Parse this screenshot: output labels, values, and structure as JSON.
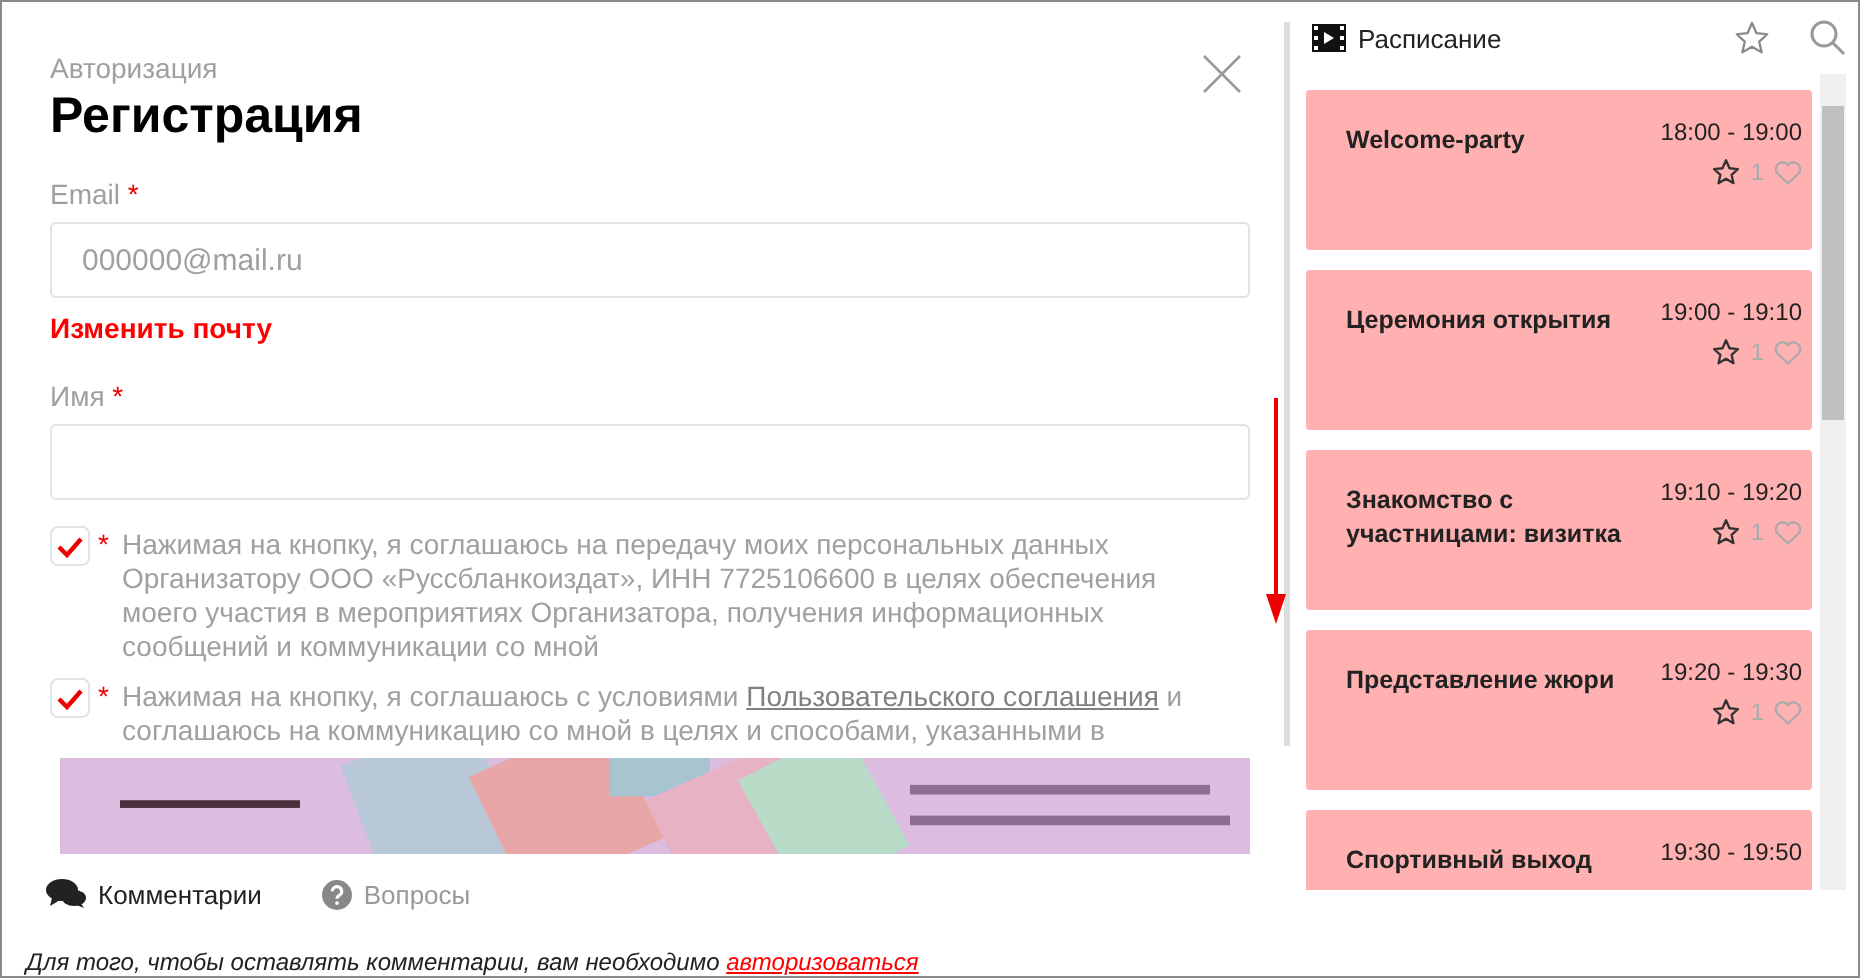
{
  "form": {
    "breadcrumb": "Авторизация",
    "title": "Регистрация",
    "fields": [
      {
        "label": "Email",
        "required_mark": "*",
        "value": "000000@mail.ru",
        "disabled": true
      },
      {
        "label": "Имя",
        "required_mark": "*"
      }
    ],
    "change_email_link": "Изменить почту",
    "consents": [
      {
        "checked": true,
        "required_mark": "*",
        "text": "Нажимая на кнопку, я соглашаюсь на передачу моих персональных данных Организатору ООО «Руссбланкоиздат», ИНН 7725106600 в целях обеспечения моего участия в мероприятиях Организатора, получения информационных сообщений и коммуникации со мной"
      },
      {
        "checked": true,
        "required_mark": "*",
        "text": "Нажимая на кнопку, я соглашаюсь с условиями",
        "link": "Пользовательского соглашения",
        "text_after": "и соглашаюсь на коммуникацию со мной в целях и способами, указанными в"
      }
    ]
  },
  "tabs": [
    {
      "label": "Комментарии",
      "selected": true
    },
    {
      "label": "Вопросы",
      "selected": false
    }
  ],
  "login_notice": {
    "text": "Для того, чтобы оставлять комментарии, вам необходимо",
    "link": "авторизоваться"
  },
  "schedule": {
    "title": "Расписание",
    "events": [
      {
        "title": "Welcome-party",
        "time": "18:00 - 19:00",
        "likes": "1"
      },
      {
        "title": "Церемония открытия",
        "time": "19:00 - 19:10",
        "likes": "1"
      },
      {
        "title": "Знакомство с участницами: визитка",
        "time": "19:10 - 19:20",
        "likes": "1"
      },
      {
        "title": "Представление жюри",
        "time": "19:20 - 19:30",
        "likes": "1"
      },
      {
        "title": "Спортивный выход",
        "time": "19:30 - 19:50"
      }
    ]
  }
}
